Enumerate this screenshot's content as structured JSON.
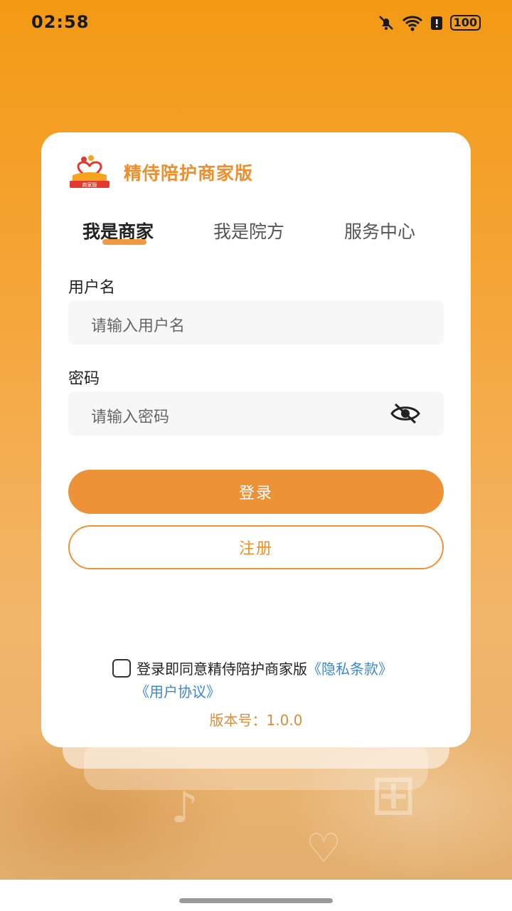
{
  "status_bar": {
    "time": "02:58",
    "battery": "100",
    "icons": [
      "bell-off-icon",
      "wifi-icon",
      "battery-saver-icon",
      "battery-icon"
    ]
  },
  "app": {
    "title": "精侍陪护商家版",
    "logo_text": "商家版"
  },
  "tabs": [
    {
      "label": "我是商家",
      "active": true
    },
    {
      "label": "我是院方",
      "active": false
    },
    {
      "label": "服务中心",
      "active": false
    }
  ],
  "form": {
    "username_label": "用户名",
    "username_placeholder": "请输入用户名",
    "password_label": "密码",
    "password_placeholder": "请输入密码"
  },
  "buttons": {
    "login": "登录",
    "register": "注册"
  },
  "agreement": {
    "text": "登录即同意精侍陪护商家版",
    "privacy_link": "《隐私条款》",
    "user_link": "《用户协议》"
  },
  "version": "版本号：1.0.0",
  "colors": {
    "accent": "#EE8F2E",
    "link": "#3B87D6",
    "background_top": "#F39A14"
  }
}
